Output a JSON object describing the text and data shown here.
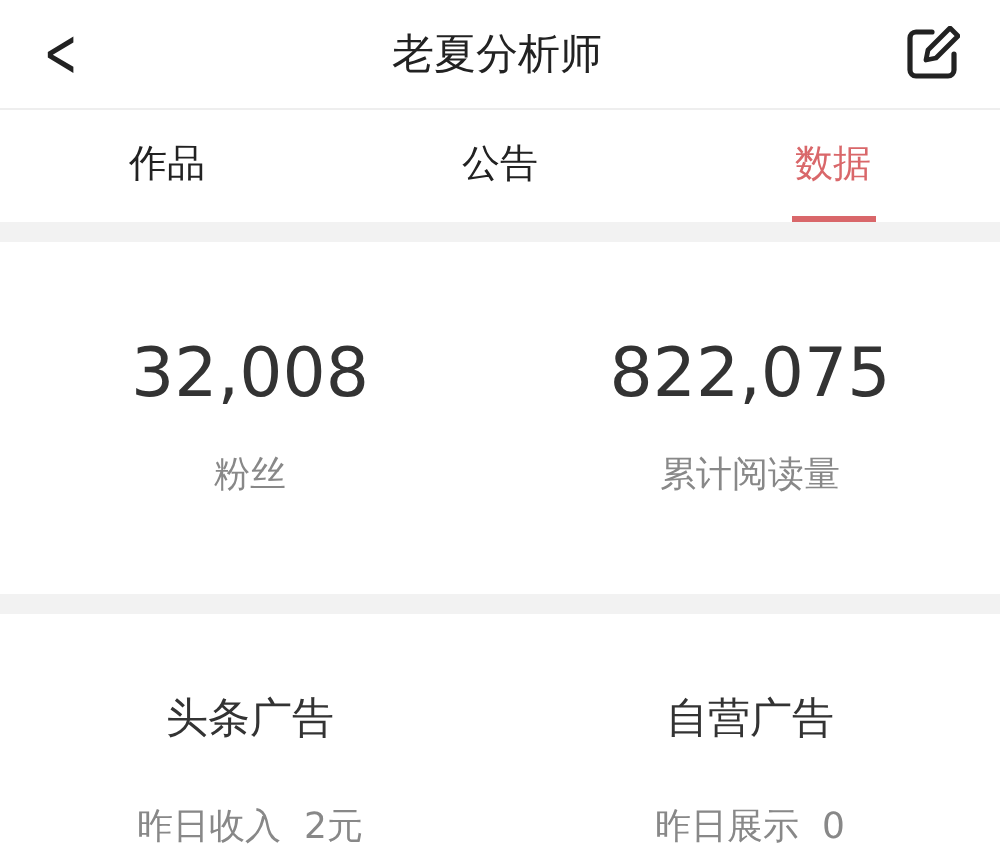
{
  "header": {
    "back": "<",
    "title": "老夏分析师"
  },
  "tabs": [
    {
      "label": "作品",
      "selected": false
    },
    {
      "label": "公告",
      "selected": false
    },
    {
      "label": "数据",
      "selected": true
    }
  ],
  "stats": [
    {
      "value": "32,008",
      "label": "粉丝"
    },
    {
      "value": "822,075",
      "label": "累计阅读量"
    }
  ],
  "ads": [
    {
      "title": "头条广告",
      "lines": [
        {
          "label": "昨日收入",
          "value": "2元"
        }
      ]
    },
    {
      "title": "自营广告",
      "lines": [
        {
          "label": "昨日展示",
          "value": "0"
        }
      ]
    }
  ]
}
